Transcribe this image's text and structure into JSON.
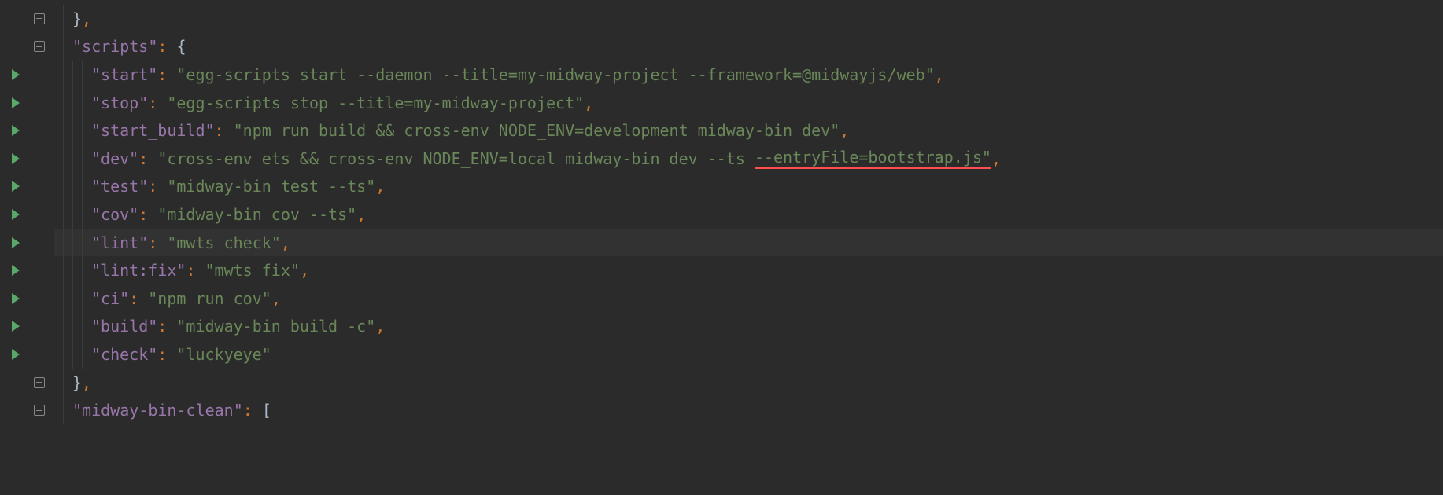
{
  "lines": {
    "close_brace": "}",
    "comma": ",",
    "open_brace": "{",
    "open_bracket": "[",
    "colon": ": ",
    "key_scripts": "\"scripts\"",
    "key_start": "\"start\"",
    "val_start": "\"egg-scripts start --daemon --title=my-midway-project --framework=@midwayjs/web\"",
    "key_stop": "\"stop\"",
    "val_stop": "\"egg-scripts stop --title=my-midway-project\"",
    "key_start_build": "\"start_build\"",
    "val_start_build": "\"npm run build && cross-env NODE_ENV=development midway-bin dev\"",
    "key_dev": "\"dev\"",
    "val_dev_pre": "\"cross-env ets && cross-env NODE_ENV=local midway-bin dev --ts ",
    "val_dev_underlined": "--entryFile=bootstrap.js\"",
    "key_test": "\"test\"",
    "val_test": "\"midway-bin test --ts\"",
    "key_cov": "\"cov\"",
    "val_cov": "\"midway-bin cov --ts\"",
    "key_lint": "\"lint\"",
    "val_lint": "\"mwts check\"",
    "key_lintfix": "\"lint:fix\"",
    "val_lintfix": "\"mwts fix\"",
    "key_ci": "\"ci\"",
    "val_ci": "\"npm run cov\"",
    "key_build": "\"build\"",
    "val_build": "\"midway-bin build -c\"",
    "key_check": "\"check\"",
    "val_check": "\"luckyeye\"",
    "key_midway_clean": "\"midway-bin-clean\""
  },
  "gutter": {
    "run_rows": [
      2,
      3,
      4,
      5,
      6,
      7,
      8,
      9,
      10,
      11,
      12
    ],
    "fold_open_rows": [
      1
    ],
    "fold_close_rows": [
      0,
      13
    ],
    "fold_open_rows2": [
      14
    ]
  }
}
